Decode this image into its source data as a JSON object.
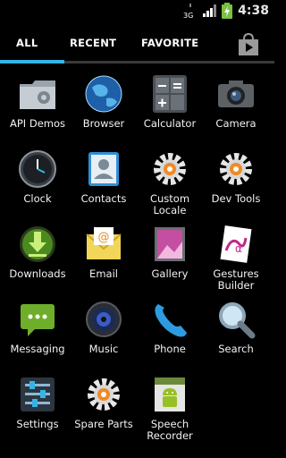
{
  "status_bar": {
    "network": "3G",
    "time": "4:38"
  },
  "tabs": [
    {
      "label": "ALL",
      "active": true
    },
    {
      "label": "RECENT",
      "active": false
    },
    {
      "label": "FAVORITE",
      "active": false
    }
  ],
  "colors": {
    "accent": "#33b5e5",
    "background": "#000000"
  },
  "apps": [
    {
      "label": "API Demos",
      "icon": "folder-gear-icon"
    },
    {
      "label": "Browser",
      "icon": "globe-icon"
    },
    {
      "label": "Calculator",
      "icon": "calculator-icon"
    },
    {
      "label": "Camera",
      "icon": "camera-icon"
    },
    {
      "label": "Clock",
      "icon": "clock-icon"
    },
    {
      "label": "Contacts",
      "icon": "contacts-icon"
    },
    {
      "label": "Custom\nLocale",
      "icon": "gear-icon"
    },
    {
      "label": "Dev Tools",
      "icon": "gear-icon"
    },
    {
      "label": "Downloads",
      "icon": "download-icon"
    },
    {
      "label": "Email",
      "icon": "email-icon"
    },
    {
      "label": "Gallery",
      "icon": "gallery-icon"
    },
    {
      "label": "Gestures\nBuilder",
      "icon": "gestures-icon"
    },
    {
      "label": "Messaging",
      "icon": "message-icon"
    },
    {
      "label": "Music",
      "icon": "speaker-icon"
    },
    {
      "label": "Phone",
      "icon": "phone-icon"
    },
    {
      "label": "Search",
      "icon": "magnifier-icon"
    },
    {
      "label": "Settings",
      "icon": "sliders-icon"
    },
    {
      "label": "Spare Parts",
      "icon": "gear-icon"
    },
    {
      "label": "Speech\nRecorder",
      "icon": "android-icon"
    }
  ]
}
